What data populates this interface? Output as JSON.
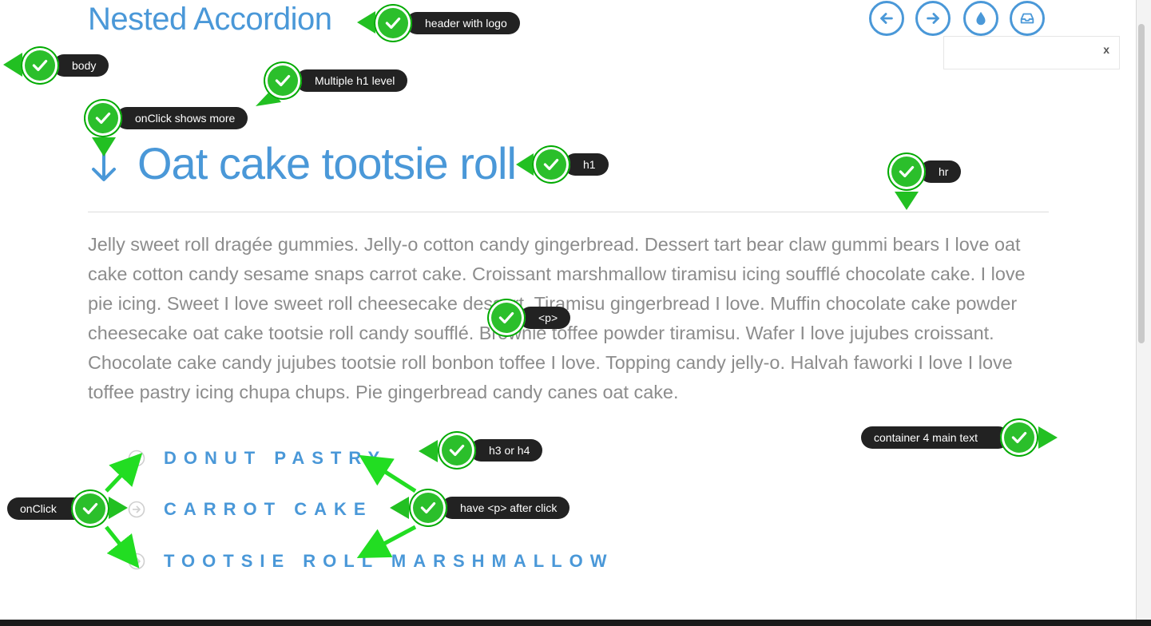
{
  "header": {
    "title": "Nested Accordion",
    "nav_icons": [
      "arrow-left-icon",
      "arrow-right-icon",
      "droplet-icon",
      "inbox-icon"
    ]
  },
  "popup": {
    "close_label": "x"
  },
  "content": {
    "h1_title": "Oat cake tootsie roll",
    "paragraph": "Jelly sweet roll dragée gummies. Jelly-o cotton candy gingerbread. Dessert tart bear claw gummi bears I love oat cake cotton candy sesame snaps carrot cake. Croissant marshmallow tiramisu icing soufflé chocolate cake. I love pie icing. Sweet I love sweet roll cheesecake dessert. Tiramisu gingerbread I love. Muffin chocolate cake powder cheesecake oat cake tootsie roll candy soufflé. Brownie toffee powder tiramisu. Wafer I love jujubes croissant. Chocolate cake candy jujubes tootsie roll bonbon toffee I love. Topping candy jelly-o. Halvah faworki I love I love toffee pastry icing chupa chups. Pie gingerbread candy canes oat cake.",
    "accordion": [
      {
        "label": "DONUT PASTRY"
      },
      {
        "label": "CARROT CAKE"
      },
      {
        "label": "TOOTSIE ROLL MARSHMALLOW"
      }
    ]
  },
  "annotations": {
    "header_with_logo": "header with logo",
    "body": "body",
    "multiple_h1": "Multiple h1 level",
    "onclick_shows_more": "onClick shows more",
    "h1": "h1",
    "hr": "hr",
    "p": "<p>",
    "container_main_text": "container 4 main text",
    "h3_or_h4": "h3 or h4",
    "onclick": "onClick",
    "have_p_after_click": "have <p> after click"
  },
  "colors": {
    "accent": "#4a98d8",
    "text": "#8c8c8c",
    "annotation_green": "#2bbf2b",
    "annotation_dark": "#222222"
  }
}
